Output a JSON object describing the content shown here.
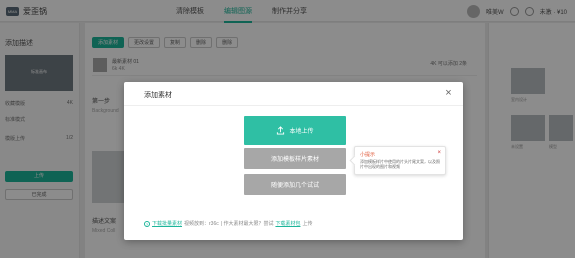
{
  "app": {
    "brand": "爱歪锅",
    "logo_text": "MMA"
  },
  "nav": {
    "items": [
      "清除模板",
      "编辑图源",
      "制作并分享"
    ],
    "active_index": 1
  },
  "user": {
    "name": "唯美W",
    "vip": "未激 · ¥10"
  },
  "left": {
    "title": "添加描述",
    "image_caption": "标准画布",
    "rows": [
      {
        "label": "收藏模版",
        "value": "4K"
      },
      {
        "label": "标准模式",
        "value": ""
      },
      {
        "label": "模版上传",
        "value": "1/2"
      }
    ],
    "btn_primary": "上传",
    "btn_secondary": "已完成"
  },
  "center": {
    "toolbar": [
      "添加素材",
      "更改设置",
      "复制",
      "删除",
      "删除"
    ],
    "card_title": "最新素材 01",
    "card_sub": "6k 4K",
    "card_meta": "4K 可以添加  2条",
    "rows": [
      {
        "title": "第一步",
        "sub": "Background"
      },
      {
        "title": "描述文案",
        "sub": "Mixed Coll"
      }
    ]
  },
  "right": {
    "labels": [
      "室内设计",
      "未设置",
      "模型"
    ]
  },
  "modal": {
    "title": "添加素材",
    "close": "×",
    "upload_label": "本地上传",
    "btn_template": "添加模板样片素材",
    "btn_more": "随便添加几个试试",
    "tip": {
      "title": "小提示",
      "text": "添加模板样片中使用的片头片尾文案，以及照片中出现的图片和视频",
      "close": "×"
    },
    "footer": {
      "link1": "下载批量素材",
      "text1": "视频放到：r36c",
      "text2": "| 作大素材最大限？尝试",
      "link2": "下载素材包",
      "text3": "上传"
    }
  }
}
